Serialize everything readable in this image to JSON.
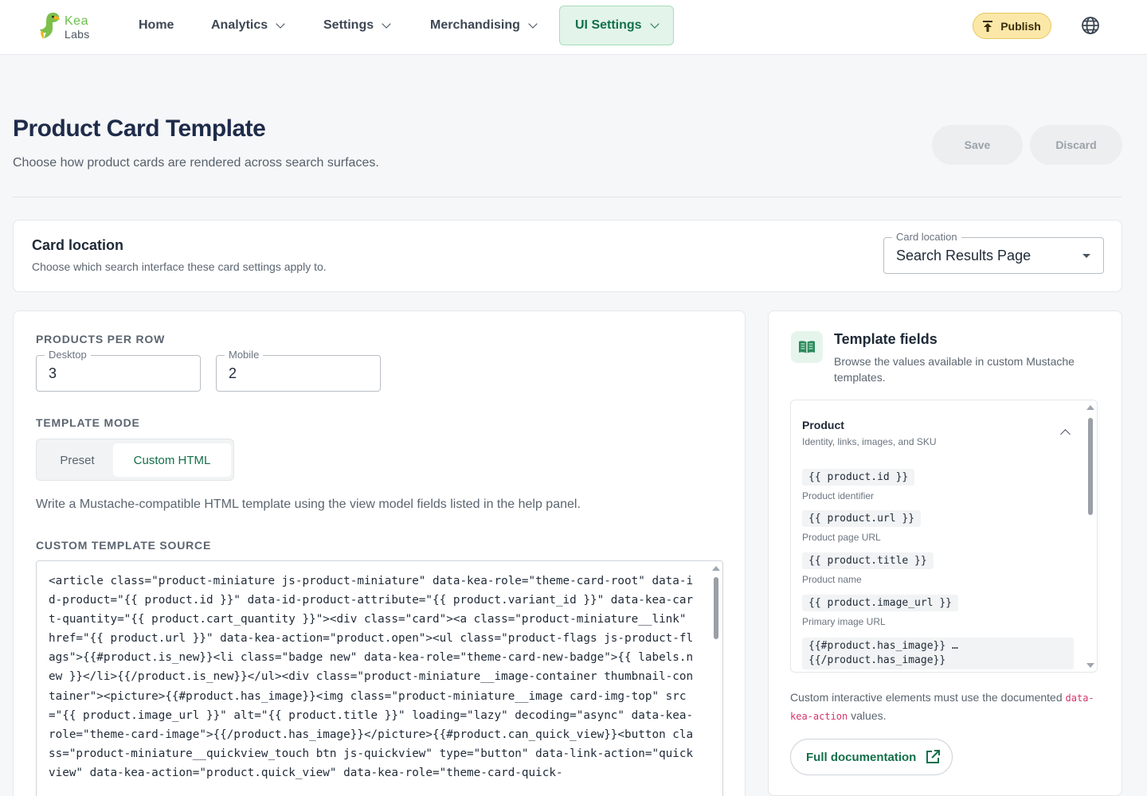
{
  "brand": {
    "line1": "Kea",
    "line2": "Labs"
  },
  "nav": {
    "home": "Home",
    "analytics": "Analytics",
    "settings": "Settings",
    "merchandising": "Merchandising",
    "ui_settings": "UI Settings",
    "publish": "Publish"
  },
  "header": {
    "title": "Product Card Template",
    "subtitle": "Choose how product cards are rendered across search surfaces.",
    "save": "Save",
    "discard": "Discard"
  },
  "card_location": {
    "title": "Card location",
    "description": "Choose which search interface these card settings apply to.",
    "select_label": "Card location",
    "select_value": "Search Results Page"
  },
  "products_per_row": {
    "label": "PRODUCTS PER ROW",
    "desktop_label": "Desktop",
    "desktop_value": "3",
    "mobile_label": "Mobile",
    "mobile_value": "2"
  },
  "template_mode": {
    "label": "TEMPLATE MODE",
    "preset": "Preset",
    "custom": "Custom HTML",
    "selected": "Custom HTML",
    "help": "Write a Mustache-compatible HTML template using the view model fields listed in the help panel."
  },
  "custom_source": {
    "label": "CUSTOM TEMPLATE SOURCE",
    "code": "<article class=\"product-miniature js-product-miniature\" data-kea-role=\"theme-card-root\" data-id-product=\"{{ product.id }}\" data-id-product-attribute=\"{{ product.variant_id }}\" data-kea-cart-quantity=\"{{ product.cart_quantity }}\"><div class=\"card\"><a class=\"product-miniature__link\" href=\"{{ product.url }}\" data-kea-action=\"product.open\"><ul class=\"product-flags js-product-flags\">{{#product.is_new}}<li class=\"badge new\" data-kea-role=\"theme-card-new-badge\">{{ labels.new }}</li>{{/product.is_new}}</ul><div class=\"product-miniature__image-container thumbnail-container\"><picture>{{#product.has_image}}<img class=\"product-miniature__image card-img-top\" src=\"{{ product.image_url }}\" alt=\"{{ product.title }}\" loading=\"lazy\" decoding=\"async\" data-kea-role=\"theme-card-image\">{{/product.has_image}}</picture>{{#product.can_quick_view}}<button class=\"product-miniature__quickview_touch btn js-quickview\" type=\"button\" data-link-action=\"quickview\" data-kea-action=\"product.quick_view\" data-kea-role=\"theme-card-quick-"
  },
  "template_fields": {
    "title": "Template fields",
    "description": "Browse the values available in custom Mustache templates.",
    "group_title": "Product",
    "group_desc": "Identity, links, images, and SKU",
    "items": [
      {
        "token": "{{ product.id }}",
        "desc": "Product identifier"
      },
      {
        "token": "{{ product.url }}",
        "desc": "Product page URL"
      },
      {
        "token": "{{ product.title }}",
        "desc": "Product name"
      },
      {
        "token": "{{ product.image_url }}",
        "desc": "Primary image URL"
      }
    ],
    "block_line1": "{{#product.has_image}} …",
    "block_line2": "{{/product.has_image}}",
    "note_before": "Custom interactive elements must use the documented ",
    "note_code": "data-kea-action",
    "note_after": " values.",
    "doc_button": "Full documentation"
  },
  "colors": {
    "accent": "#13704a",
    "nav_active_bg": "#e3f4ea",
    "publish_bg": "#fbe8a8",
    "code_highlight": "#d6336c"
  },
  "icons": {
    "publish": "upload-icon",
    "language": "globe-icon",
    "template_fields": "book-icon",
    "documentation": "external-link-icon"
  }
}
